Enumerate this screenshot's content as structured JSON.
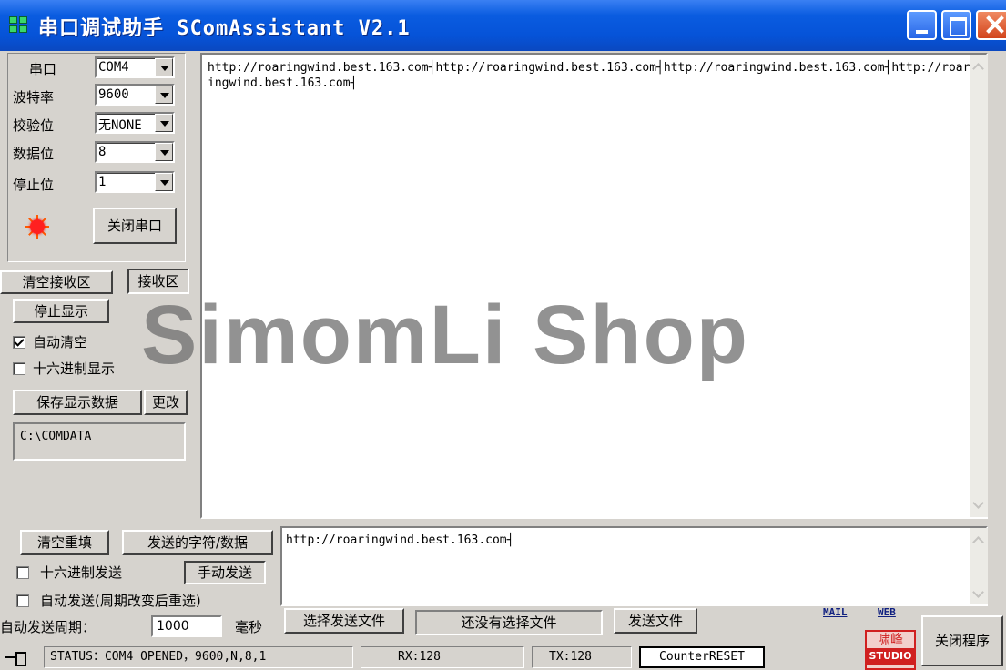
{
  "window": {
    "title": "串口调试助手  SComAssistant  V2.1"
  },
  "serial": {
    "port_label": "串口",
    "port_value": "COM4",
    "baud_label": "波特率",
    "baud_value": "9600",
    "parity_label": "校验位",
    "parity_value": "无NONE",
    "databits_label": "数据位",
    "databits_value": "8",
    "stopbits_label": "停止位",
    "stopbits_value": "1",
    "close_port_button": "关闭串口"
  },
  "receive": {
    "clear_button": "清空接收区",
    "receive_button": "接收区",
    "stop_display_button": "停止显示",
    "auto_clear_label": "自动清空",
    "auto_clear_checked": true,
    "hex_display_label": "十六进制显示",
    "hex_display_checked": false,
    "save_button": "保存显示数据",
    "change_button": "更改",
    "save_path": "C:\\COMDATA",
    "text": "http://roaringwind.best.163.com┤http://roaringwind.best.163.com┤http://roaringwind.best.163.com┤http://roaringwind.best.163.com┤"
  },
  "watermark": "SimomLi Shop",
  "send": {
    "clear_button": "清空重填",
    "chars_button": "发送的字符/数据",
    "text": "http://roaringwind.best.163.com┤",
    "hex_send_label": "十六进制发送",
    "hex_send_checked": false,
    "manual_send_button": "手动发送",
    "auto_send_label": "自动发送(周期改变后重选)",
    "auto_send_checked": false,
    "period_label": "自动发送周期：",
    "period_value": "1000",
    "period_unit": "毫秒",
    "select_file_button": "选择发送文件",
    "file_status": "还没有选择文件",
    "send_file_button": "发送文件"
  },
  "links": {
    "mail": "MAIL",
    "web": "WEB"
  },
  "stamp": {
    "line1": "啸峰",
    "line2": "STUDIO"
  },
  "exit_button": "关闭程序",
  "status": {
    "status_text": "STATUS：COM4 OPENED，9600,N,8,1",
    "rx": "RX:128",
    "tx": "TX:128",
    "counter_reset": "CounterRESET"
  }
}
